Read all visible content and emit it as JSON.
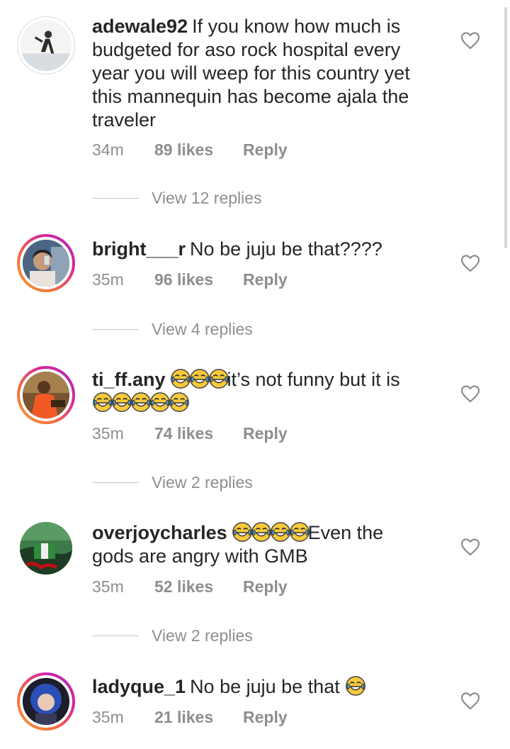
{
  "comments": [
    {
      "username": "adewale92",
      "text": "If you know how much is budgeted for aso rock hospital every year you will weep for this country yet this mannequin has become ajala the traveler",
      "time": "34m",
      "likes": "89 likes",
      "reply": "Reply",
      "view_replies": "View 12 replies",
      "avatar_ring": false
    },
    {
      "username": "bright___r",
      "text": "No be juju be that????",
      "time": "35m",
      "likes": "96 likes",
      "reply": "Reply",
      "view_replies": "View 4 replies",
      "avatar_ring": true
    },
    {
      "username": "ti_ff.any",
      "text_after_emoji": "it’s not funny but it is",
      "emoji_before": 3,
      "emoji_after": 5,
      "time": "35m",
      "likes": "74 likes",
      "reply": "Reply",
      "view_replies": "View 2 replies",
      "avatar_ring": true
    },
    {
      "username": "overjoycharles",
      "text_line1": "Even the",
      "text_line2": "gods are angry with GMB",
      "emoji_before": 4,
      "time": "35m",
      "likes": "52 likes",
      "reply": "Reply",
      "view_replies": "View 2 replies",
      "avatar_ring": false
    },
    {
      "username": "ladyque_1",
      "text": "No be juju be that",
      "emoji_after": 1,
      "time": "35m",
      "likes": "21 likes",
      "reply": "Reply",
      "avatar_ring": true
    }
  ],
  "icons": {
    "like": "heart-outline-icon",
    "emoji": "face-with-tears-of-joy"
  },
  "colors": {
    "text": "#262626",
    "muted": "#8e8e8e",
    "ring_start": "#f9a13c",
    "ring_end": "#a52fbf"
  }
}
